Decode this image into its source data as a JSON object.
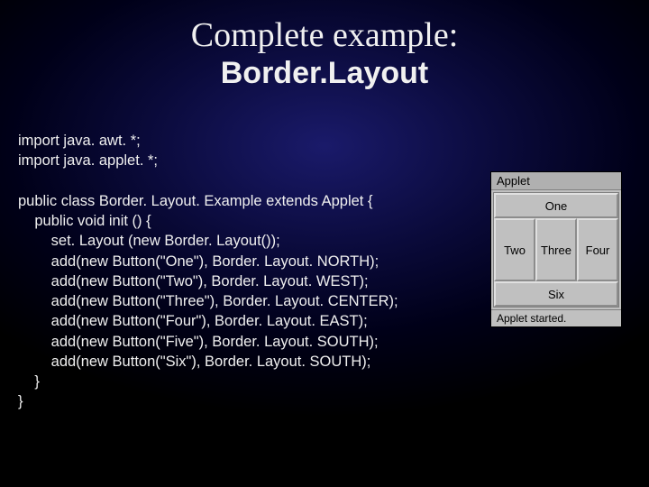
{
  "title": {
    "line1": "Complete example:",
    "line2": "Border.Layout"
  },
  "code": "import java. awt. *;\nimport java. applet. *;\n\npublic class Border. Layout. Example extends Applet {\n    public void init () {\n        set. Layout (new Border. Layout());\n        add(new Button(\"One\"), Border. Layout. NORTH);\n        add(new Button(\"Two\"), Border. Layout. WEST);\n        add(new Button(\"Three\"), Border. Layout. CENTER);\n        add(new Button(\"Four\"), Border. Layout. EAST);\n        add(new Button(\"Five\"), Border. Layout. SOUTH);\n        add(new Button(\"Six\"), Border. Layout. SOUTH);\n    }\n}",
  "applet": {
    "title": "Applet",
    "north": "One",
    "west": "Two",
    "center": "Three",
    "east": "Four",
    "south": "Six",
    "status": "Applet started."
  }
}
